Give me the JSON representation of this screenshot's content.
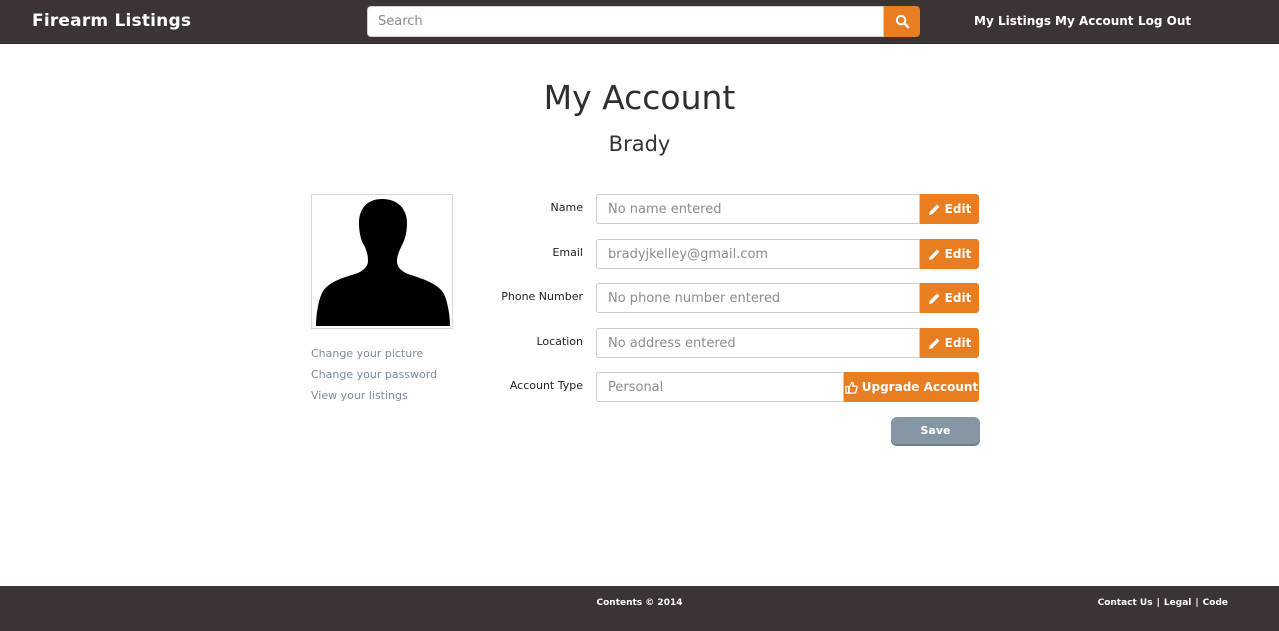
{
  "navbar": {
    "brand": "Firearm Listings",
    "search_placeholder": "Search",
    "links": [
      "My Listings",
      "My Account",
      "Log Out"
    ]
  },
  "page": {
    "title": "My Account",
    "user_name": "Brady"
  },
  "sidebar": {
    "links": [
      "Change your picture",
      "Change your password",
      "View your listings"
    ]
  },
  "form": {
    "fields": [
      {
        "label": "Name",
        "placeholder": "No name entered",
        "button": "Edit"
      },
      {
        "label": "Email",
        "placeholder": "bradyjkelley@gmail.com",
        "button": "Edit"
      },
      {
        "label": "Phone Number",
        "placeholder": "No phone number entered",
        "button": "Edit"
      },
      {
        "label": "Location",
        "placeholder": "No address entered",
        "button": "Edit"
      }
    ],
    "account_type": {
      "label": "Account Type",
      "placeholder": "Personal",
      "button": "Upgrade Account"
    },
    "save_label": "Save"
  },
  "footer": {
    "copyright": "Contents © 2014",
    "links": [
      "Contact Us",
      "Legal",
      "Code"
    ],
    "separator": "|"
  },
  "colors": {
    "header_bg": "#3c3335",
    "accent": "#e87d22",
    "save_button": "#8796a4"
  }
}
